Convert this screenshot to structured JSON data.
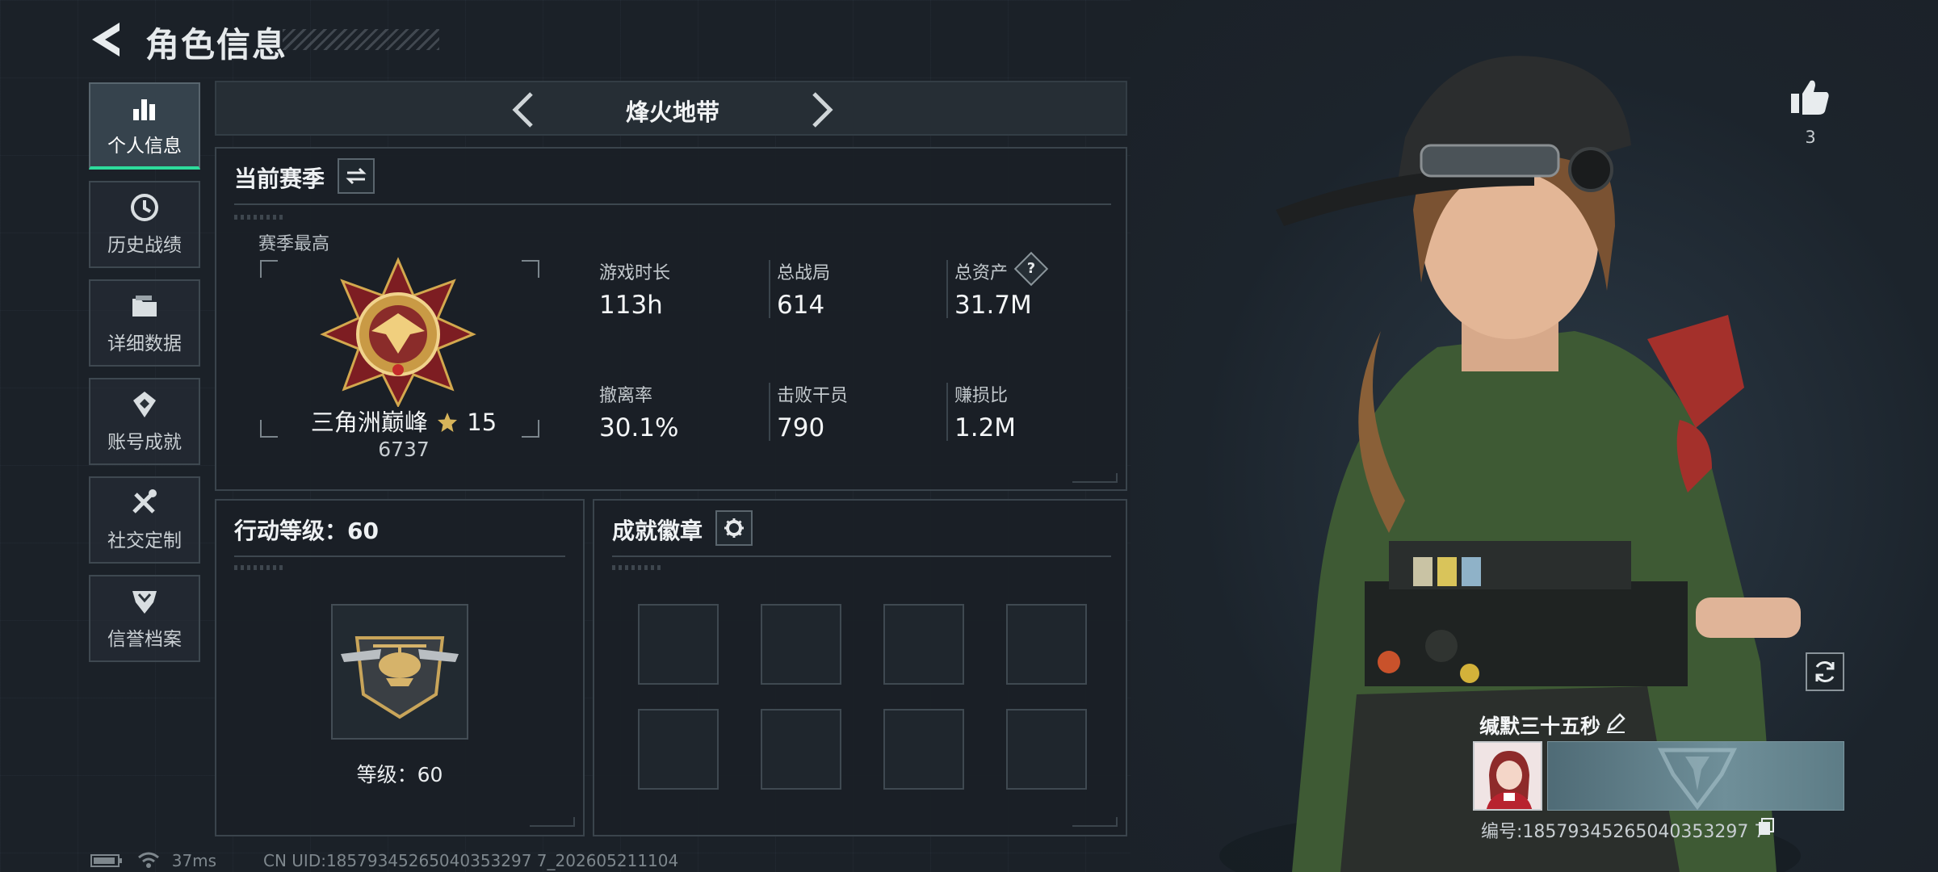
{
  "header": {
    "title": "角色信息"
  },
  "nav": {
    "items": [
      {
        "label": "个人信息",
        "icon": "bar-chart-icon",
        "active": true
      },
      {
        "label": "历史战绩",
        "icon": "history-clock-icon",
        "active": false
      },
      {
        "label": "详细数据",
        "icon": "folder-icon",
        "active": false
      },
      {
        "label": "账号成就",
        "icon": "achievement-icon",
        "active": false
      },
      {
        "label": "社交定制",
        "icon": "tools-icon",
        "active": false
      },
      {
        "label": "信誉档案",
        "icon": "shield-crest-icon",
        "active": false
      }
    ]
  },
  "mode": {
    "title": "烽火地带"
  },
  "season": {
    "title": "当前赛季",
    "best_label": "赛季最高",
    "rank_name": "三角洲巅峰",
    "rank_stars": "15",
    "rank_score": "6737",
    "stats": [
      {
        "label": "游戏时长",
        "value": "113h"
      },
      {
        "label": "总战局",
        "value": "614"
      },
      {
        "label": "总资产",
        "value": "31.7M",
        "help": "?"
      },
      {
        "label": "撤离率",
        "value": "30.1%"
      },
      {
        "label": "击败干员",
        "value": "790"
      },
      {
        "label": "赚损比",
        "value": "1.2M"
      }
    ]
  },
  "level": {
    "title": "行动等级：60",
    "label": "等级：60"
  },
  "badges": {
    "title": "成就徽章",
    "slot_count": 8
  },
  "status": {
    "ping": "37ms",
    "uid": "CN UID:18579345265040353297 7_202605211104"
  },
  "profile": {
    "likes": "3",
    "name": "缄默三十五秒",
    "id": "编号:18579345265040353297 7"
  },
  "colors": {
    "accent": "#2ddc9c",
    "panel_border": "#3a444c",
    "background": "#1b2128"
  }
}
